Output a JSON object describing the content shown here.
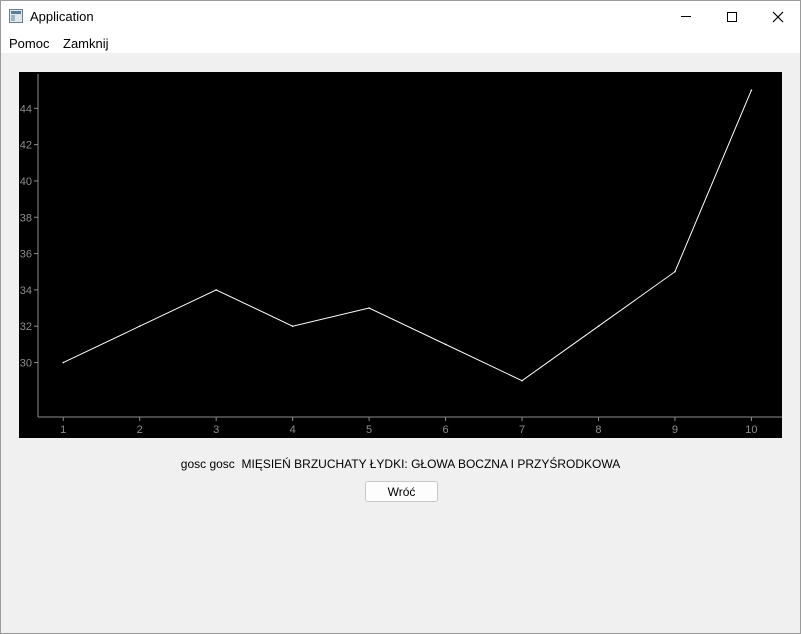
{
  "window": {
    "title": "Application",
    "icon": "app-window-icon"
  },
  "menu": {
    "items": [
      "Pomoc",
      "Zamknij"
    ]
  },
  "info": {
    "user": "gosc gosc",
    "muscle": "MIĘSIEŃ BRZUCHATY ŁYDKI: GŁOWA BOCZNA I PRZYŚRODKOWA"
  },
  "buttons": {
    "back_label": "Wróć"
  },
  "colors": {
    "chart_background": "#000000",
    "line": "#ffffff",
    "axis": "#8c8c8c",
    "window_bg": "#f0f0f0"
  },
  "chart_data": {
    "type": "line",
    "x": [
      1,
      2,
      3,
      4,
      5,
      6,
      7,
      8,
      9,
      10
    ],
    "series": [
      {
        "values": [
          30,
          32,
          34,
          32,
          33,
          31,
          29,
          32,
          35,
          45
        ]
      }
    ],
    "x_ticks": [
      1,
      2,
      3,
      4,
      5,
      6,
      7,
      8,
      9,
      10
    ],
    "y_ticks": [
      30,
      32,
      34,
      36,
      38,
      40,
      42,
      44
    ],
    "xlim": [
      0.67,
      10.4
    ],
    "ylim": [
      27,
      46
    ],
    "grid": false,
    "title": "",
    "xlabel": "",
    "ylabel": ""
  }
}
